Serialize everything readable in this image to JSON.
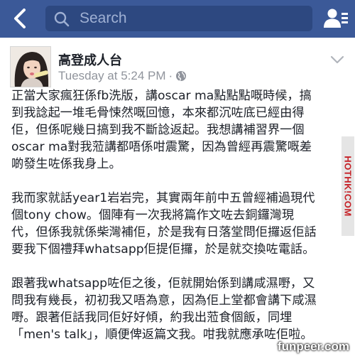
{
  "navbar": {
    "search_placeholder": "Search",
    "background_color": "#3b5998",
    "icons": {
      "back": "chevron-left-icon",
      "search": "magnifier-icon",
      "friends": "friend-requests-icon"
    }
  },
  "post": {
    "author": "高登成人台",
    "timestamp": "Tuesday at 5:24 PM",
    "separator": "·",
    "privacy_icon": "globe-icon",
    "menu_icon": "chevron-down-icon",
    "paragraphs": [
      "正當大家瘋狂係fb洗版，講oscar ma點點點嘅時候，搞\n到我諗起一堆毛骨悚然嘅回憶，本來都沉咗底已經由得\n佢，但係呢幾日搞到我不斷諗返起。我想講補習界一個\noscar ma對我蒞講都唔係咁震驚，因為曾經再震驚嘅差\n啲發生咗係我身上。",
      "我而家就話year1岩岩完，其實兩年前中五曾經補過現代\n個tony chow。個陣有一次我將篇作文咗去銅鑼灣現\n代，但係我就係柴灣補佢，於是我有日落堂問佢攞返佢話\n要我下個禮拜whatsapp佢提佢攞，於是就交換咗電話。",
      "跟著我whatsapp咗佢之後，佢就開始係到講咸濕嘢，又\n問我有幾長，初初我又唔為意，因為佢上堂都會講下咸濕\n嘢。跟著佢話我同佢好好傾，約我出蒞食個飯，同埋\n「men's talk」，順便俾返篇文我。咁我就應承咗佢啦。"
    ]
  },
  "watermarks": {
    "side": "HOTHK!COM",
    "bottom": "funpeer.com"
  }
}
